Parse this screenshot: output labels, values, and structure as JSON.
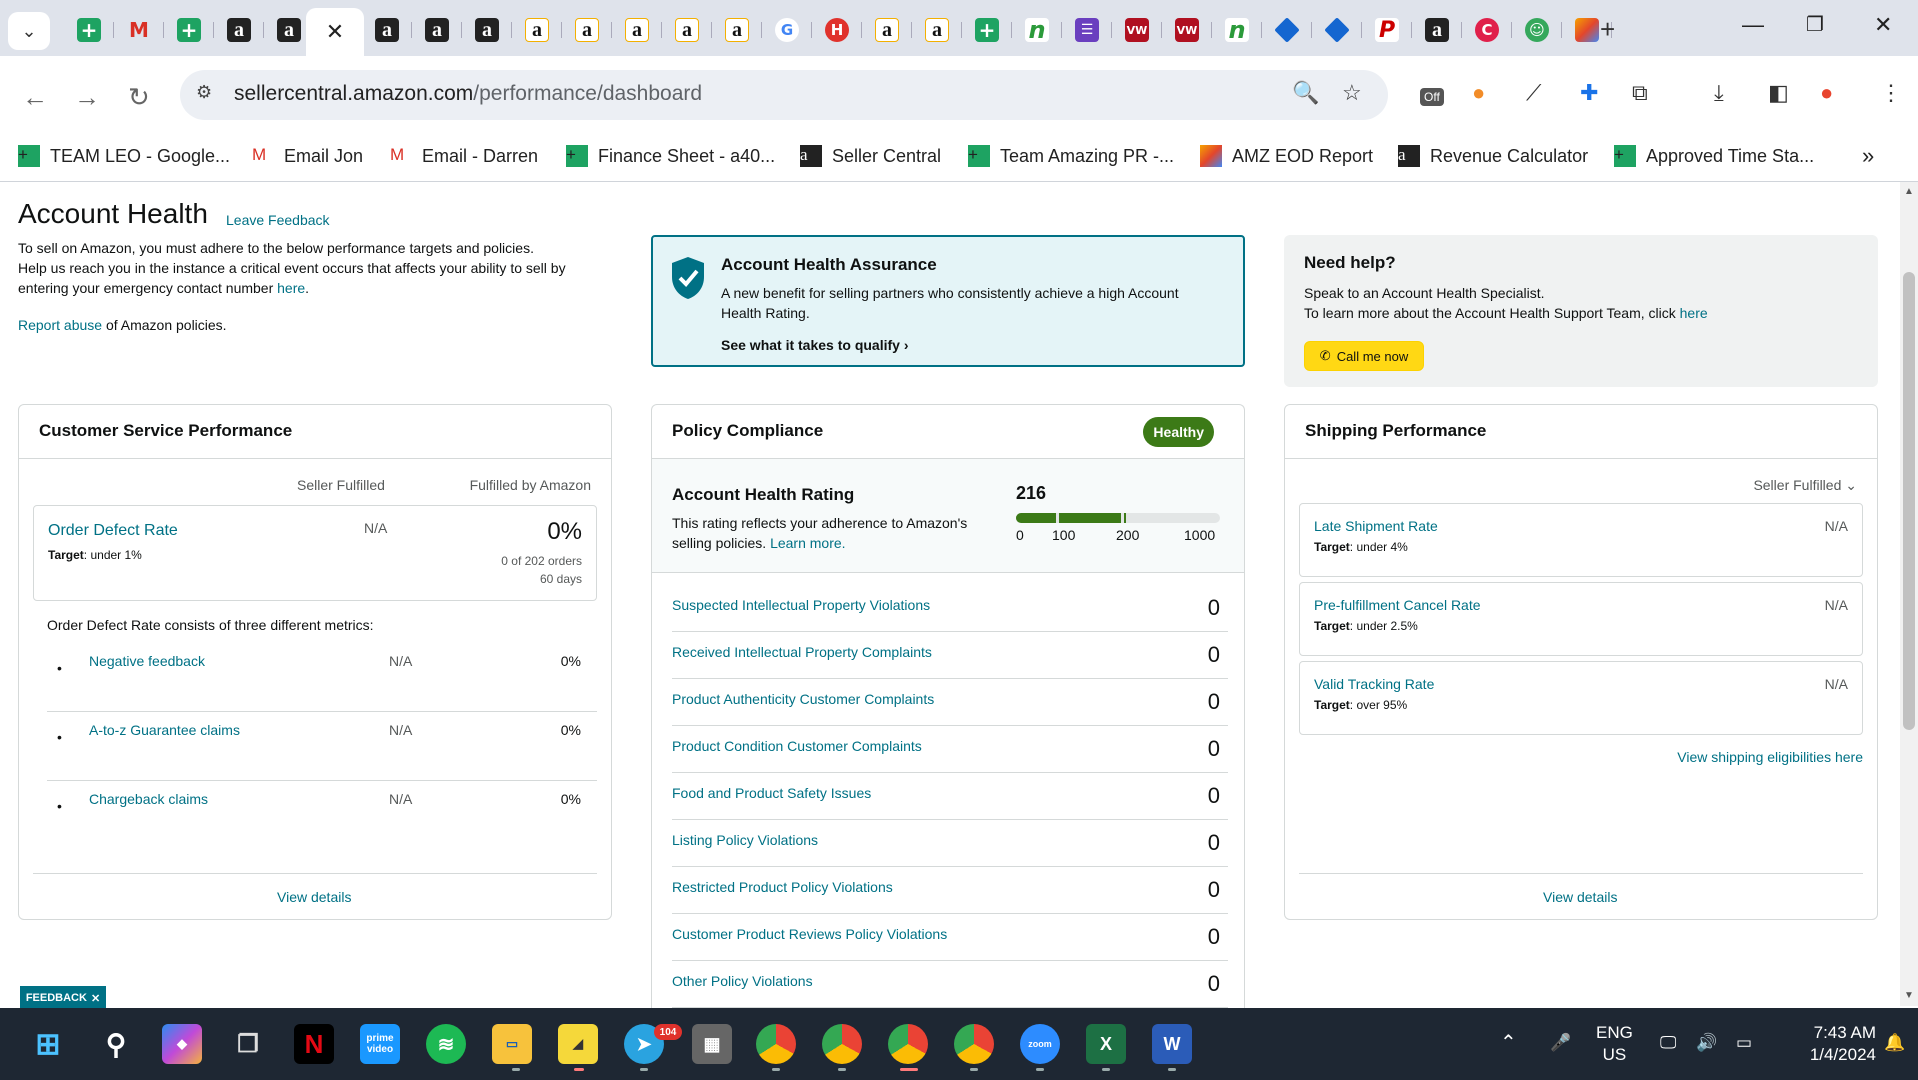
{
  "browser": {
    "url_domain": "sellercentral.amazon.com",
    "url_path": "/performance/dashboard",
    "active_tab_close": "✕",
    "new_tab": "+",
    "tab_icons": [
      "sheets",
      "gmail",
      "sheets",
      "amazon",
      "amazon",
      "amazon",
      "amazon",
      "amazon",
      "amazon",
      "amazon",
      "amazon",
      "amazon",
      "amazon",
      "google",
      "helium10",
      "amazon",
      "amazon",
      "sheets",
      "n-extension",
      "list",
      "vw",
      "vw",
      "n-extension",
      "jira",
      "jira",
      "pinterest",
      "amazon",
      "c-extension",
      "bot",
      "zapier"
    ],
    "extension_badge": "Off",
    "bookmarks": [
      {
        "icon": "sheets",
        "label": "TEAM LEO - Google..."
      },
      {
        "icon": "gmail",
        "label": "Email Jon"
      },
      {
        "icon": "gmail",
        "label": "Email - Darren"
      },
      {
        "icon": "sheets",
        "label": "Finance Sheet - a40..."
      },
      {
        "icon": "amazon",
        "label": "Seller Central"
      },
      {
        "icon": "sheets",
        "label": "Team Amazing PR -..."
      },
      {
        "icon": "zapier",
        "label": "AMZ EOD Report"
      },
      {
        "icon": "amazon",
        "label": "Revenue Calculator"
      },
      {
        "icon": "sheets",
        "label": "Approved Time Sta..."
      }
    ],
    "more": "»"
  },
  "page": {
    "title": "Account Health",
    "leave_feedback": "Leave Feedback",
    "intro_1": "To sell on Amazon, you must adhere to the below performance targets and policies.",
    "intro_2": "Help us reach you in the instance a critical event occurs that affects your ability to sell by entering your emergency contact number",
    "intro_link": "here",
    "report_abuse": "Report abuse",
    "report_rest": "of Amazon policies."
  },
  "assurance": {
    "title": "Account Health Assurance",
    "text": "A new benefit for selling partners who consistently achieve a high Account Health Rating.",
    "link": "See what it takes to qualify"
  },
  "help": {
    "title": "Need help?",
    "line1": "Speak to an Account Health Specialist.",
    "line2": "To learn more about the Account Health Support Team, click",
    "line2_link": "here",
    "call_button": "Call me now"
  },
  "csp": {
    "title": "Customer Service Performance",
    "col_seller": "Seller Fulfilled",
    "col_fba": "Fulfilled by Amazon",
    "odr": {
      "name": "Order Defect Rate",
      "target_label": "Target",
      "target": ": under 1%",
      "seller": "N/A",
      "fba": "0%",
      "orders": "0 of 202 orders",
      "days": "60 days"
    },
    "metrics_intro": "Order Defect Rate consists of three different metrics:",
    "metrics": [
      {
        "name": "Negative feedback",
        "seller": "N/A",
        "fba": "0%"
      },
      {
        "name": "A-to-z Guarantee claims",
        "seller": "N/A",
        "fba": "0%"
      },
      {
        "name": "Chargeback claims",
        "seller": "N/A",
        "fba": "0%"
      }
    ],
    "view_details": "View details"
  },
  "policy": {
    "title": "Policy Compliance",
    "status": "Healthy",
    "ahr_title": "Account Health Rating",
    "ahr_text": "This rating reflects your adherence to Amazon's selling policies.",
    "ahr_link": "Learn more.",
    "ahr_score": "216",
    "ahr_ticks": [
      "0",
      "100",
      "200",
      "1000"
    ],
    "rows": [
      {
        "name": "Suspected Intellectual Property Violations",
        "value": "0"
      },
      {
        "name": "Received Intellectual Property Complaints",
        "value": "0"
      },
      {
        "name": "Product Authenticity Customer Complaints",
        "value": "0"
      },
      {
        "name": "Product Condition Customer Complaints",
        "value": "0"
      },
      {
        "name": "Food and Product Safety Issues",
        "value": "0"
      },
      {
        "name": "Listing Policy Violations",
        "value": "0"
      },
      {
        "name": "Restricted Product Policy Violations",
        "value": "0"
      },
      {
        "name": "Customer Product Reviews Policy Violations",
        "value": "0"
      },
      {
        "name": "Other Policy Violations",
        "value": "0"
      }
    ]
  },
  "shipping": {
    "title": "Shipping Performance",
    "selector": "Seller Fulfilled",
    "rows": [
      {
        "name": "Late Shipment Rate",
        "target_label": "Target",
        "target": ": under 4%",
        "value": "N/A"
      },
      {
        "name": "Pre-fulfillment Cancel Rate",
        "target_label": "Target",
        "target": ": under 2.5%",
        "value": "N/A"
      },
      {
        "name": "Valid Tracking Rate",
        "target_label": "Target",
        "target": ": over 95%",
        "value": "N/A"
      }
    ],
    "eligibility": "View shipping eligibilities here",
    "view_details": "View details"
  },
  "feedback_tab": "FEEDBACK",
  "taskbar": {
    "apps": [
      "start",
      "search",
      "copilot",
      "task-view",
      "netflix",
      "prime-video",
      "spotify",
      "file-explorer",
      "sticky-notes",
      "telegram",
      "calculator",
      "chrome",
      "chrome",
      "chrome",
      "chrome",
      "zoom",
      "excel",
      "word"
    ],
    "telegram_badge": "104",
    "prime_label": "prime video",
    "zoom_label": "zoom",
    "lang_1": "ENG",
    "lang_2": "US",
    "time": "7:43 AM",
    "date": "1/4/2024"
  }
}
